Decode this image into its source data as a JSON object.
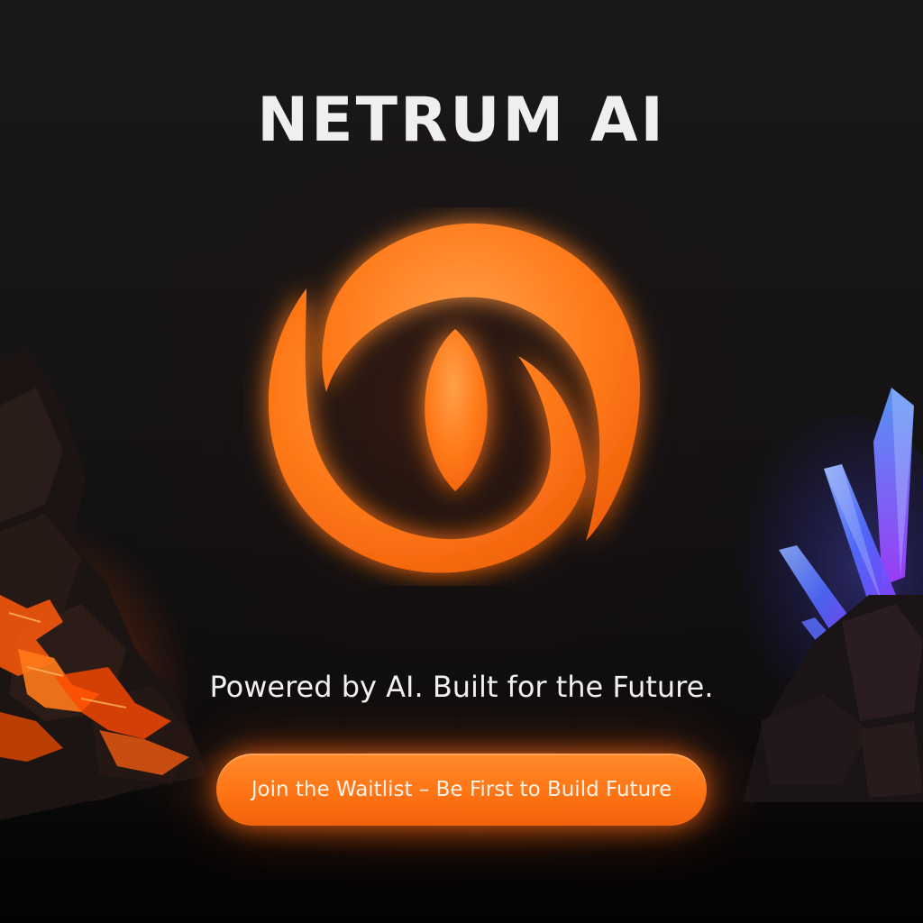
{
  "brand": {
    "title": "NETRUM AI",
    "logo_icon": "netrum-swirl-logo-icon",
    "accent_color": "#ff7a1a"
  },
  "hero": {
    "tagline": "Powered by AI. Built for the Future."
  },
  "cta": {
    "label": "Join the Waitlist – Be First to Build Future",
    "color": "#ff7a1a"
  },
  "scene": {
    "left_decoration": "lava-rocks-icon",
    "right_decoration": "blue-crystals-icon",
    "crystal_color": "#4f7bff"
  }
}
